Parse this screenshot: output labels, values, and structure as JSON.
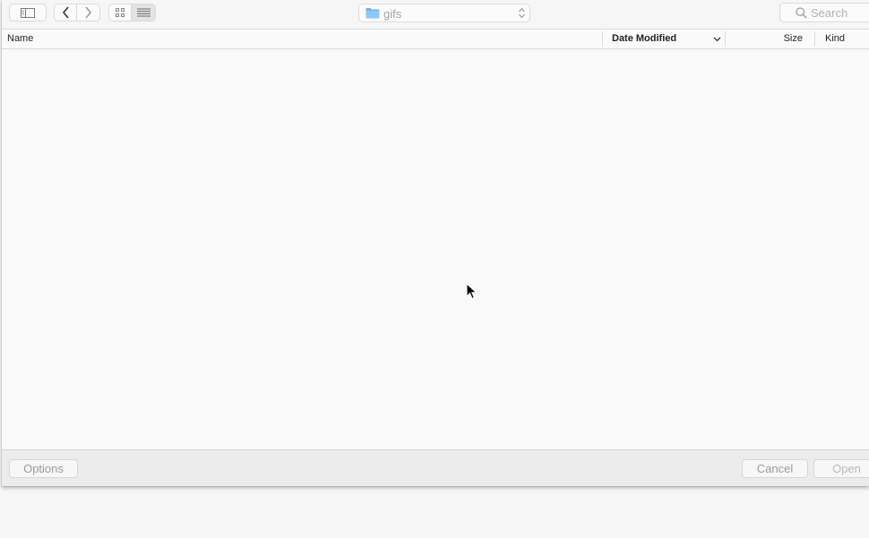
{
  "toolbar": {
    "sidebar_toggle_icon": "sidebar-icon",
    "back_icon": "chevron-left-icon",
    "forward_icon": "chevron-right-icon",
    "icon_view_icon": "grid-icon",
    "list_view_icon": "list-icon",
    "folder_icon": "folder-icon",
    "path_label": "gifs",
    "search_placeholder": "Search"
  },
  "columns": {
    "name": "Name",
    "date_modified": "Date Modified",
    "size": "Size",
    "kind": "Kind"
  },
  "files": [],
  "footer": {
    "options_label": "Options",
    "cancel_label": "Cancel",
    "open_label": "Open"
  },
  "colors": {
    "folder": "#6ab5f2",
    "window_bg": "#f6f6f6",
    "disabled_text": "#9a9a9a"
  }
}
